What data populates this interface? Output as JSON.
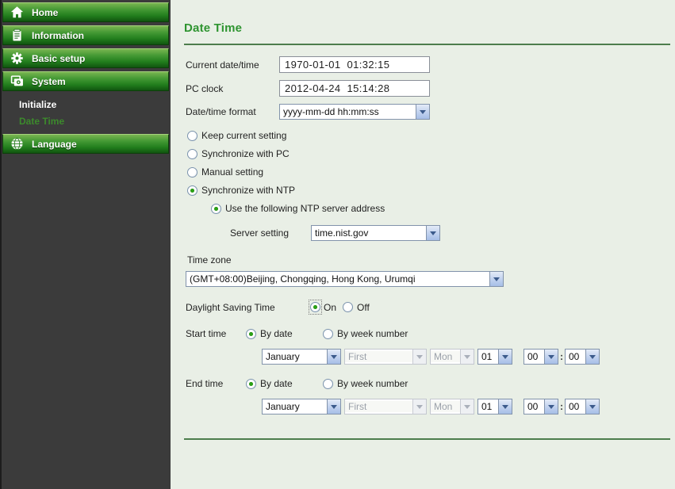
{
  "colors": {
    "page_background": "#e9efe6",
    "sidebar_background": "#3b3b3b",
    "nav_green_dark": "#115510",
    "title_green": "#2e9430",
    "rule_green": "#4d7d4d",
    "active_subitem_green": "#3c8a2c",
    "radio_dot_green": "#2aa315"
  },
  "sidebar": {
    "items": [
      {
        "label": "Home",
        "icon": "home-icon"
      },
      {
        "label": "Information",
        "icon": "information-icon"
      },
      {
        "label": "Basic setup",
        "icon": "gear-icon"
      },
      {
        "label": "System",
        "icon": "system-icon"
      },
      {
        "label": "Language",
        "icon": "globe-icon"
      }
    ],
    "system_subitems": [
      {
        "label": "Initialize",
        "active": false
      },
      {
        "label": "Date Time",
        "active": true
      }
    ]
  },
  "main": {
    "title": "Date Time",
    "fields": {
      "current": {
        "label": "Current date/time",
        "value": "1970-01-01  01:32:15"
      },
      "pc_clock": {
        "label": "PC clock",
        "value": "2012-04-24  15:14:28"
      },
      "format": {
        "label": "Date/time format",
        "value": "yyyy-mm-dd hh:mm:ss"
      }
    },
    "sync_options": [
      {
        "label": "Keep current setting",
        "selected": false
      },
      {
        "label": "Synchronize with PC",
        "selected": false
      },
      {
        "label": "Manual setting",
        "selected": false
      },
      {
        "label": "Synchronize with NTP",
        "selected": true
      }
    ],
    "ntp": {
      "use_server": {
        "label": "Use the following NTP server address",
        "selected": true
      },
      "server_setting": {
        "label": "Server setting",
        "value": "time.nist.gov"
      }
    },
    "timezone": {
      "label": "Time zone",
      "value": "(GMT+08:00)Beijing, Chongqing, Hong Kong, Urumqi"
    },
    "dst": {
      "label": "Daylight Saving Time",
      "on": "On",
      "off": "Off",
      "selected": "On"
    },
    "start_time": {
      "label": "Start time",
      "by_date": "By date",
      "by_week": "By week number",
      "selected": "By date",
      "month": "January",
      "week": "First",
      "weekday": "Mon",
      "day": "01",
      "hour": "00",
      "minute": "00",
      "separator": ":"
    },
    "end_time": {
      "label": "End time",
      "by_date": "By date",
      "by_week": "By week number",
      "selected": "By date",
      "month": "January",
      "week": "First",
      "weekday": "Mon",
      "day": "01",
      "hour": "00",
      "minute": "00",
      "separator": ":"
    }
  }
}
